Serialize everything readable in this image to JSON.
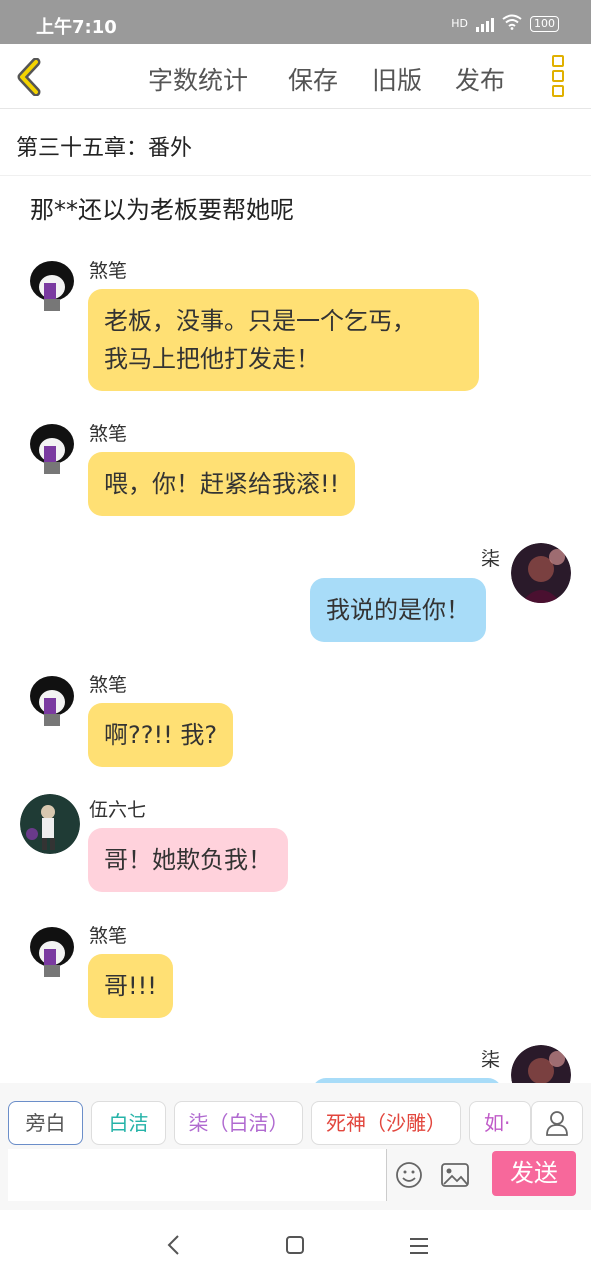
{
  "status": {
    "time": "上午7:10",
    "net": "HD",
    "battery": "100"
  },
  "toolbar": {
    "word_count": "字数统计",
    "save": "保存",
    "old_version": "旧版",
    "publish": "发布"
  },
  "chapter": {
    "title": "第三十五章：番外"
  },
  "narration": "那**还以为老板要帮她呢",
  "messages": [
    {
      "name": "煞笔",
      "text_lines": [
        "老板，没事。只是一个乞丐，",
        "我马上把他打发走！"
      ]
    },
    {
      "name": "煞笔",
      "text": "喂，你！赶紧给我滚!!"
    },
    {
      "name": "柒",
      "text": "我说的是你！"
    },
    {
      "name": "煞笔",
      "text": "啊??!! 我?"
    },
    {
      "name": "伍六七",
      "text": "哥！她欺负我！"
    },
    {
      "name": "煞笔",
      "text": "哥!!!"
    },
    {
      "name": "柒",
      "text": ""
    }
  ],
  "roles": [
    "旁白",
    "白洁",
    "柒（白洁）",
    "死神（沙雕）",
    "如·"
  ],
  "role_colors": {
    "白洁": "#26b3a8",
    "柒（白洁）": "#b06ad0",
    "死神（沙雕）": "#e2463d",
    "如·": "#c05ac8"
  },
  "composer": {
    "send": "发送",
    "input_value": ""
  },
  "icons": [
    "back-icon",
    "menu-dots-icon",
    "role-person-icon",
    "emoji-icon",
    "image-icon",
    "nav-back-icon",
    "nav-home-icon",
    "nav-menu-icon"
  ]
}
